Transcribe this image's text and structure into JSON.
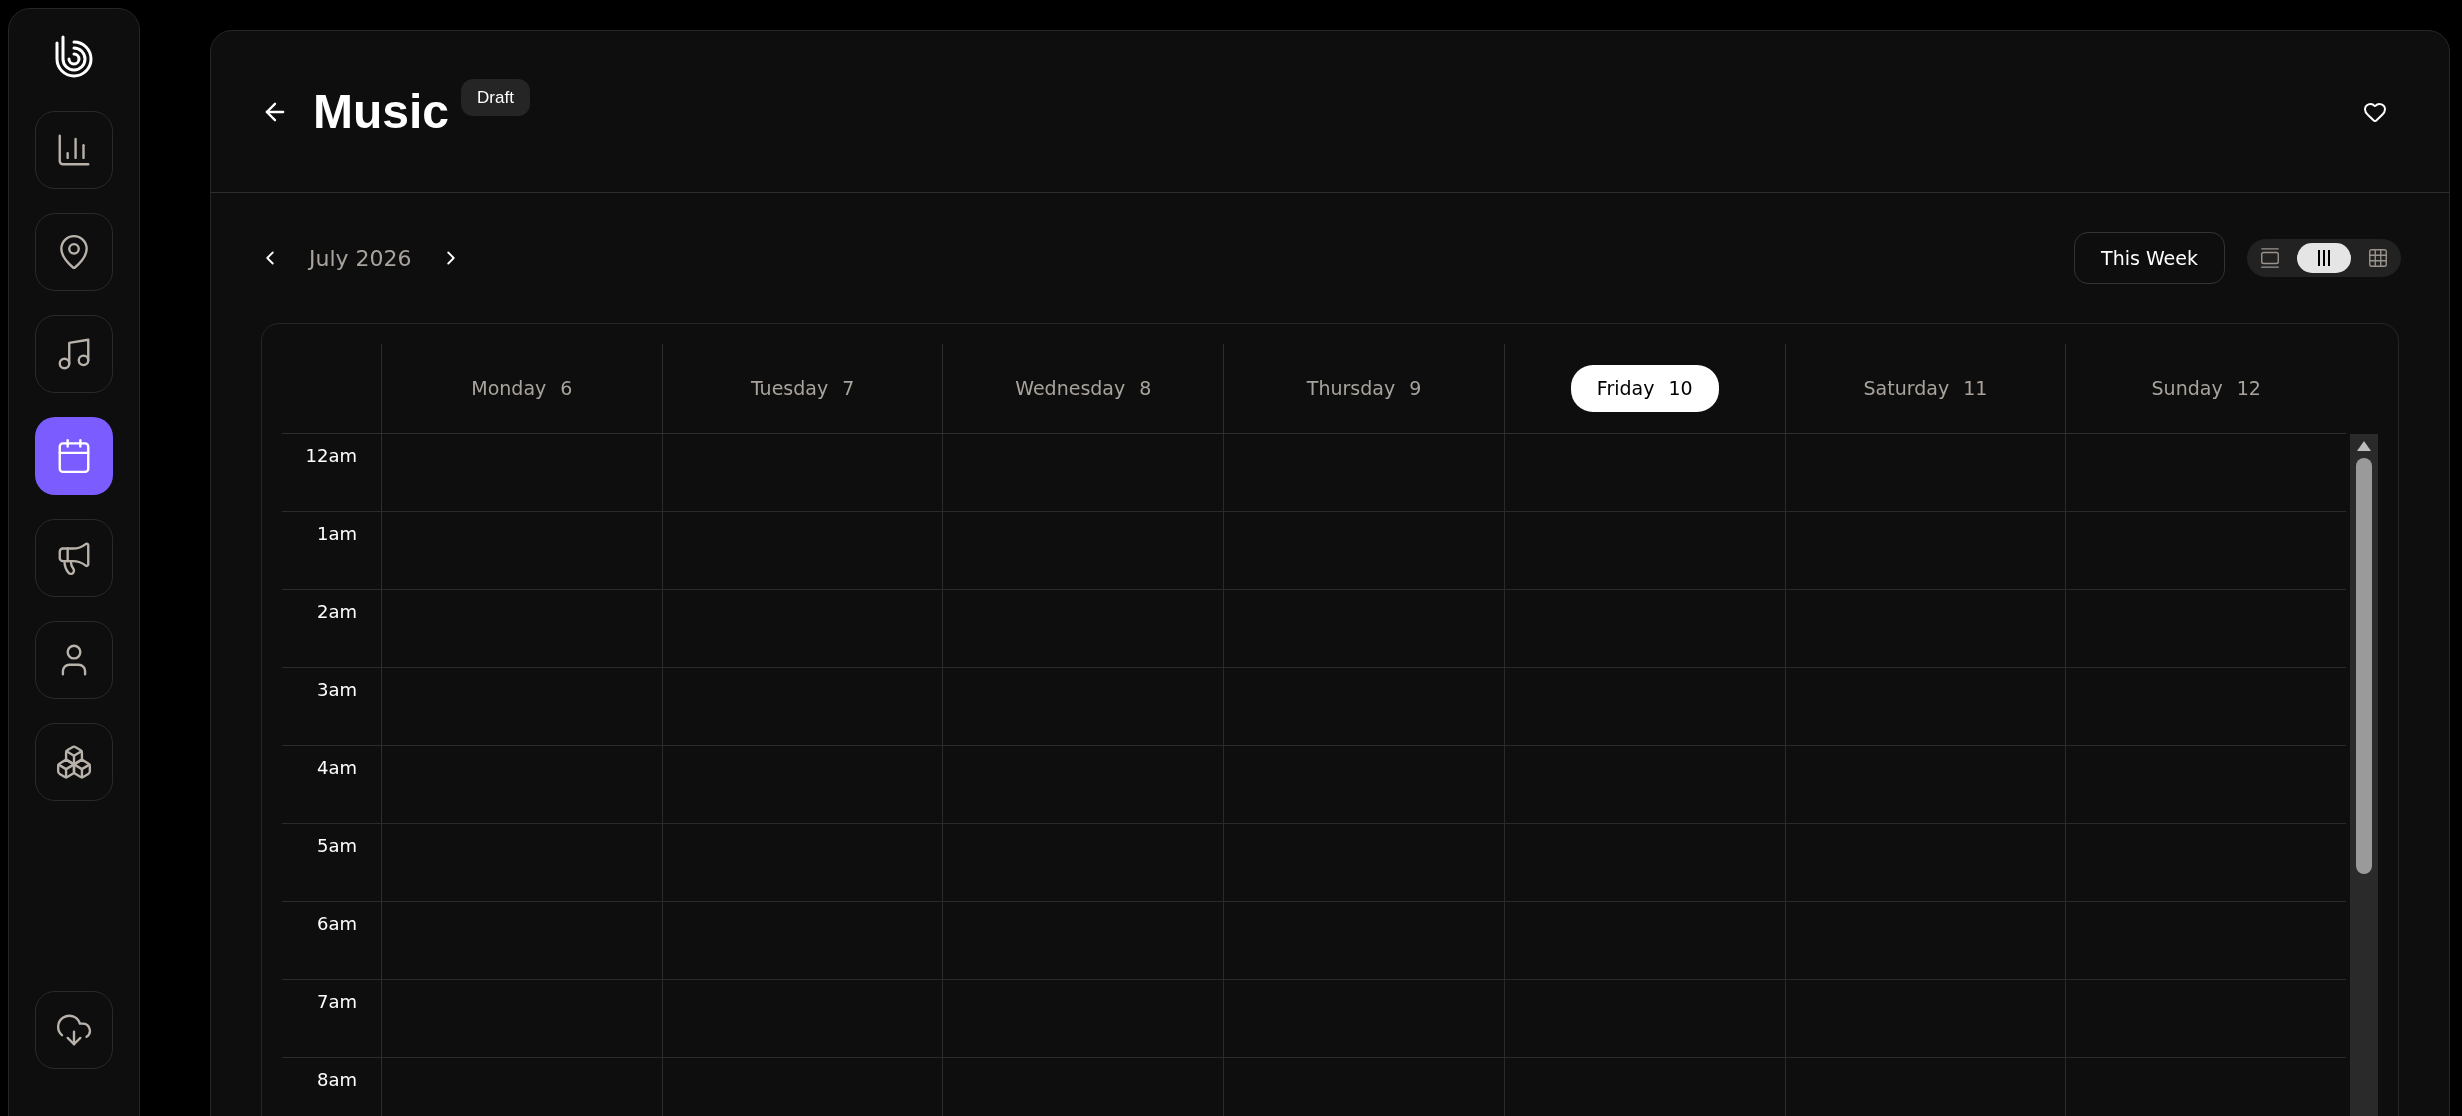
{
  "sidebar": {
    "items": [
      {
        "selected": false
      },
      {
        "selected": false
      },
      {
        "selected": false
      },
      {
        "selected": true
      },
      {
        "selected": false
      },
      {
        "selected": false
      },
      {
        "selected": false
      }
    ]
  },
  "header": {
    "title": "Music",
    "badge": "Draft",
    "favorite": false
  },
  "toolbar": {
    "month": "July 2026",
    "range_button": "This Week",
    "views": [
      {
        "kind": "day",
        "selected": false
      },
      {
        "kind": "week",
        "selected": true
      },
      {
        "kind": "month",
        "selected": false
      }
    ]
  },
  "calendar": {
    "days": [
      {
        "day": "Monday",
        "date": "6",
        "selected": false
      },
      {
        "day": "Tuesday",
        "date": "7",
        "selected": false
      },
      {
        "day": "Wednesday",
        "date": "8",
        "selected": false
      },
      {
        "day": "Thursday",
        "date": "9",
        "selected": false
      },
      {
        "day": "Friday",
        "date": "10",
        "selected": true
      },
      {
        "day": "Saturday",
        "date": "11",
        "selected": false
      },
      {
        "day": "Sunday",
        "date": "12",
        "selected": false
      }
    ],
    "hours": [
      "12am",
      "1am",
      "2am",
      "3am",
      "4am",
      "5am",
      "6am",
      "7am",
      "8am"
    ]
  }
}
